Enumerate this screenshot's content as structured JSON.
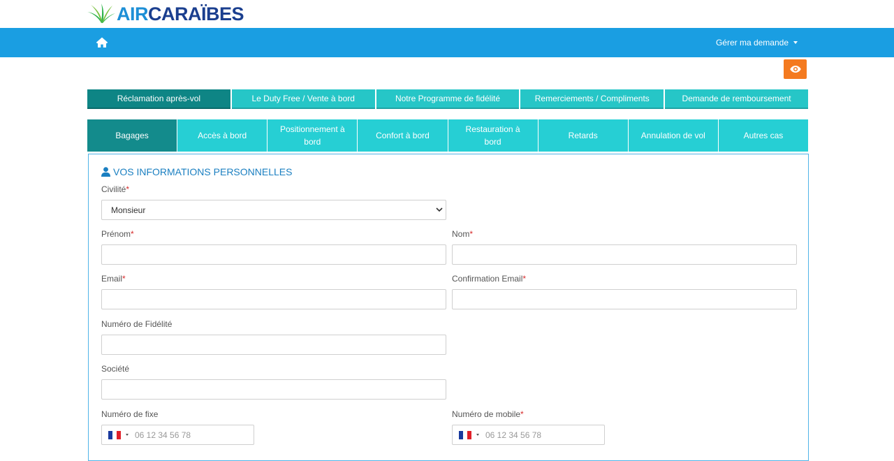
{
  "brand": {
    "air": "AIR",
    "caraibes": "CARAÏBES"
  },
  "nav": {
    "manage_label": "Gérer ma demande"
  },
  "category_tabs": [
    {
      "label": "Réclamation après-vol",
      "active": true
    },
    {
      "label": "Le Duty Free / Vente à bord",
      "active": false
    },
    {
      "label": "Notre Programme de fidélité",
      "active": false
    },
    {
      "label": "Remerciements / Compliments",
      "active": false
    },
    {
      "label": "Demande de remboursement",
      "active": false
    }
  ],
  "sub_tabs": [
    {
      "label": "Bagages",
      "active": true
    },
    {
      "label": "Accès à bord",
      "active": false
    },
    {
      "label": "Positionnement à bord",
      "active": false
    },
    {
      "label": "Confort à bord",
      "active": false
    },
    {
      "label": "Restauration à bord",
      "active": false
    },
    {
      "label": "Retards",
      "active": false
    },
    {
      "label": "Annulation de vol",
      "active": false
    },
    {
      "label": "Autres cas",
      "active": false
    }
  ],
  "form": {
    "section_title": "VOS INFORMATIONS PERSONNELLES",
    "civilite": {
      "label": "Civilité",
      "value": "Monsieur"
    },
    "prenom": {
      "label": "Prénom",
      "value": ""
    },
    "nom": {
      "label": "Nom",
      "value": ""
    },
    "email": {
      "label": "Email",
      "value": ""
    },
    "email_confirm": {
      "label": "Confirmation Email",
      "value": ""
    },
    "fidelite": {
      "label": "Numéro de Fidélité",
      "value": ""
    },
    "societe": {
      "label": "Société",
      "value": ""
    },
    "fixe": {
      "label": "Numéro de fixe",
      "placeholder": "06 12 34 56 78"
    },
    "mobile": {
      "label": "Numéro de mobile",
      "placeholder": "06 12 34 56 78"
    },
    "required_mark": "*"
  },
  "colors": {
    "navbar": "#1a9ee2",
    "tab": "#26c6c7",
    "tab_active": "#0e8585",
    "eye_button": "#f47a1f",
    "required": "#d62b2b"
  }
}
